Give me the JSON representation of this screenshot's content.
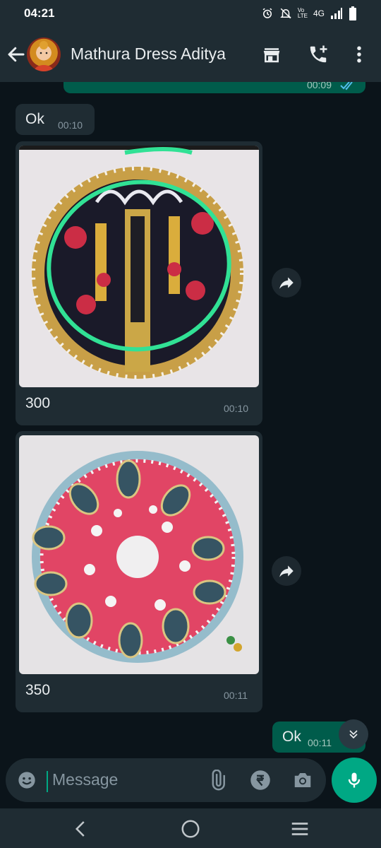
{
  "status_bar": {
    "time": "04:21",
    "network": "4G"
  },
  "header": {
    "contact_name": "Mathura Dress Aditya"
  },
  "messages": [
    {
      "type": "outgoing",
      "time": "00:09"
    },
    {
      "type": "incoming",
      "text": "Ok",
      "time": "00:10"
    },
    {
      "type": "incoming_image",
      "caption": "300",
      "time": "00:10"
    },
    {
      "type": "incoming_image",
      "caption": "350",
      "time": "00:11"
    },
    {
      "type": "outgoing",
      "text": "Ok",
      "time": "00:11"
    }
  ],
  "composer": {
    "placeholder": "Message"
  },
  "colors": {
    "header": "#1f2c33",
    "background": "#0b141a",
    "outgoing": "#005c4b",
    "accent": "#00a884",
    "incoming": "#1f2c33"
  },
  "icons": [
    "back-arrow-icon",
    "store-icon",
    "call-add-icon",
    "more-vert-icon",
    "share-forward-icon",
    "emoji-icon",
    "attach-icon",
    "rupee-icon",
    "camera-icon",
    "mic-icon",
    "scroll-down-icon",
    "nav-back-icon",
    "nav-home-icon",
    "nav-recents-icon"
  ]
}
